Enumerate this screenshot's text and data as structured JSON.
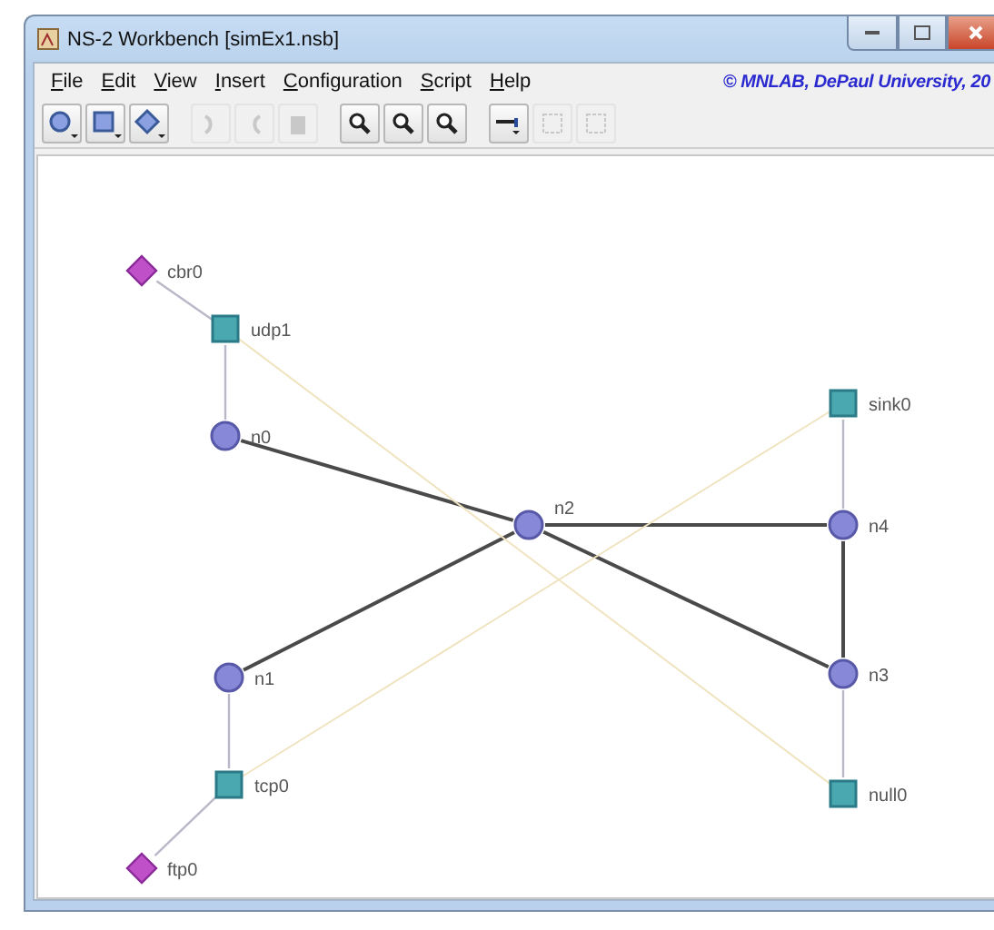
{
  "window": {
    "title": "NS-2 Workbench [simEx1.nsb]"
  },
  "menu": [
    {
      "label": "File"
    },
    {
      "label": "Edit"
    },
    {
      "label": "View"
    },
    {
      "label": "Insert"
    },
    {
      "label": "Configuration"
    },
    {
      "label": "Script"
    },
    {
      "label": "Help"
    }
  ],
  "copyright": "© MNLAB, DePaul University, 20",
  "toolbar": [
    {
      "kind": "node",
      "disabled": false
    },
    {
      "kind": "agent",
      "disabled": false
    },
    {
      "kind": "application",
      "disabled": false
    },
    {
      "kind": "redo",
      "disabled": true
    },
    {
      "kind": "undo",
      "disabled": true
    },
    {
      "kind": "delete",
      "disabled": true
    },
    {
      "kind": "zoom",
      "disabled": false
    },
    {
      "kind": "zoom-in",
      "disabled": false
    },
    {
      "kind": "zoom-out",
      "disabled": false
    },
    {
      "kind": "link",
      "disabled": false
    },
    {
      "kind": "group",
      "disabled": true
    },
    {
      "kind": "ungroup",
      "disabled": true
    }
  ],
  "nodes": [
    {
      "label": "cbr0",
      "kind": "application"
    },
    {
      "label": "udp1",
      "kind": "agent"
    },
    {
      "label": "n0",
      "kind": "node"
    },
    {
      "label": "n2",
      "kind": "node"
    },
    {
      "label": "sink0",
      "kind": "agent"
    },
    {
      "label": "n4",
      "kind": "node"
    },
    {
      "label": "n3",
      "kind": "node"
    },
    {
      "label": "n1",
      "kind": "node"
    },
    {
      "label": "tcp0",
      "kind": "agent"
    },
    {
      "label": "null0",
      "kind": "agent"
    },
    {
      "label": "ftp0",
      "kind": "application"
    }
  ],
  "links": [
    {
      "kind": "attach"
    },
    {
      "kind": "attach"
    },
    {
      "kind": "duplex"
    },
    {
      "kind": "duplex"
    },
    {
      "kind": "duplex"
    },
    {
      "kind": "duplex"
    },
    {
      "kind": "duplex"
    },
    {
      "kind": "attach"
    },
    {
      "kind": "attach"
    },
    {
      "kind": "attach"
    },
    {
      "kind": "attach"
    },
    {
      "kind": "connection"
    },
    {
      "kind": "connection"
    }
  ]
}
